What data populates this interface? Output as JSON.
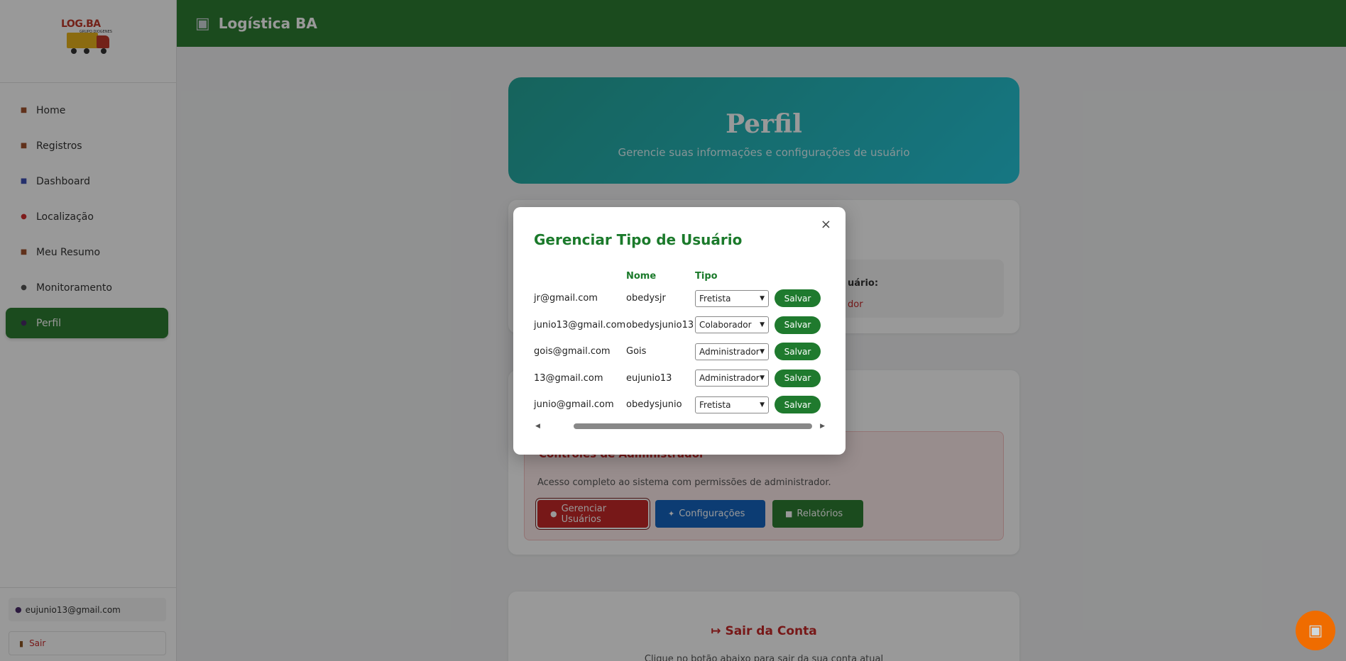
{
  "header": {
    "title": "Logística BA",
    "icon": "truck-icon"
  },
  "sidebar": {
    "logo_text": "LOG.BA",
    "logo_sub": "GRUPO DIOGENES",
    "items": [
      {
        "label": "Home",
        "icon": "home-icon",
        "active": false
      },
      {
        "label": "Registros",
        "icon": "records-icon",
        "active": false
      },
      {
        "label": "Dashboard",
        "icon": "dashboard-icon",
        "active": false
      },
      {
        "label": "Localização",
        "icon": "pin-icon",
        "active": false
      },
      {
        "label": "Meu Resumo",
        "icon": "summary-icon",
        "active": false
      },
      {
        "label": "Monitoramento",
        "icon": "monitor-icon",
        "active": false
      },
      {
        "label": "Perfil",
        "icon": "user-icon",
        "active": true
      }
    ],
    "user_email": "eujunio13@gmail.com",
    "logout_label": "Sair"
  },
  "hero": {
    "title": "Perfil",
    "subtitle": "Gerencie suas informações e configurações de usuário"
  },
  "info": {
    "label_partial": "uário:",
    "value_partial": "dor"
  },
  "admin": {
    "title": "Controles de Administrador",
    "description": "Acesso completo ao sistema com permissões de administrador.",
    "buttons": {
      "manage": "Gerenciar Usuários",
      "settings": "Configurações",
      "reports": "Relatórios"
    }
  },
  "logout_card": {
    "title": "Sair da Conta",
    "description": "Clique no botão abaixo para sair da sua conta atual"
  },
  "modal": {
    "title": "Gerenciar Tipo de Usuário",
    "close": "×",
    "headers": {
      "email": "",
      "name": "Nome",
      "type": "Tipo",
      "action": ""
    },
    "rows": [
      {
        "email": "jr@gmail.com",
        "name": "obedysjr",
        "type": "Fretista",
        "action": "Salvar"
      },
      {
        "email": "junio13@gmail.com",
        "name": "obedysjunio13",
        "type": "Colaborador",
        "action": "Salvar"
      },
      {
        "email": "gois@gmail.com",
        "name": "Gois",
        "type": "Administrador",
        "action": "Salvar"
      },
      {
        "email": "13@gmail.com",
        "name": "eujunio13",
        "type": "Administrador",
        "action": "Salvar"
      },
      {
        "email": "junio@gmail.com",
        "name": "obedysjunio",
        "type": "Fretista",
        "action": "Salvar"
      }
    ]
  },
  "colors": {
    "primary_green": "#2e7d32",
    "danger_red": "#c62828",
    "blue": "#1565c0",
    "orange": "#ef6c00"
  }
}
